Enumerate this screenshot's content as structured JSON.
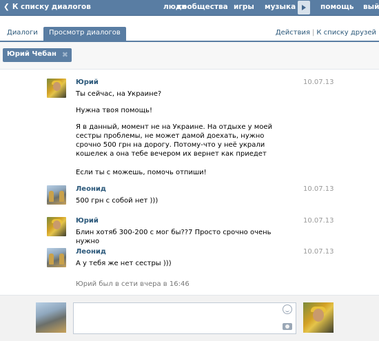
{
  "topbar": {
    "back_label": "К списку диалогов",
    "nav": [
      "люди",
      "сообщества",
      "игры",
      "музыка",
      "помощь",
      "вый"
    ]
  },
  "tabs": {
    "dialogs": "Диалоги",
    "view_dialogs": "Просмотр диалогов",
    "actions": "Действия",
    "back_to_friends": "К списку друзей"
  },
  "recipient": {
    "name": "Юрий Чебан"
  },
  "messages": [
    {
      "author": "Юрий",
      "date": "10.07.13",
      "texts": [
        "Ты сейчас, на Украине?",
        "Нужна твоя помощь!",
        "Я в данный, момент не на Украине. На отдыхе у моей сестры проблемы, не может дамой доехать, нужно срочно 500 грн на дорогу. Потому-что у неё украли кошелек а она тебе вечером их вернет как приедет",
        "Если ты с можешь, помочь отпиши!"
      ]
    },
    {
      "author": "Леонид",
      "date": "10.07.13",
      "texts": [
        "500 грн с собой нет )))"
      ]
    },
    {
      "author": "Юрий",
      "date": "10.07.13",
      "texts": [
        "Блин хотяб 300-200 с мог бы??7 Просто срочно очень нужно"
      ]
    },
    {
      "author": "Леонид",
      "date": "10.07.13",
      "texts": [
        "А у тебя же нет сестры )))"
      ]
    }
  ],
  "status": "Юрий был в сети вчера в 16:46",
  "composer": {
    "value": "",
    "placeholder": ""
  },
  "icons": {
    "back": "chevron-left-icon",
    "player": "play-icon",
    "remove": "close-icon",
    "smile": "smile-icon",
    "camera": "camera-icon"
  },
  "colors": {
    "header": "#597da3",
    "link": "#2b587a",
    "muted": "#999999"
  }
}
